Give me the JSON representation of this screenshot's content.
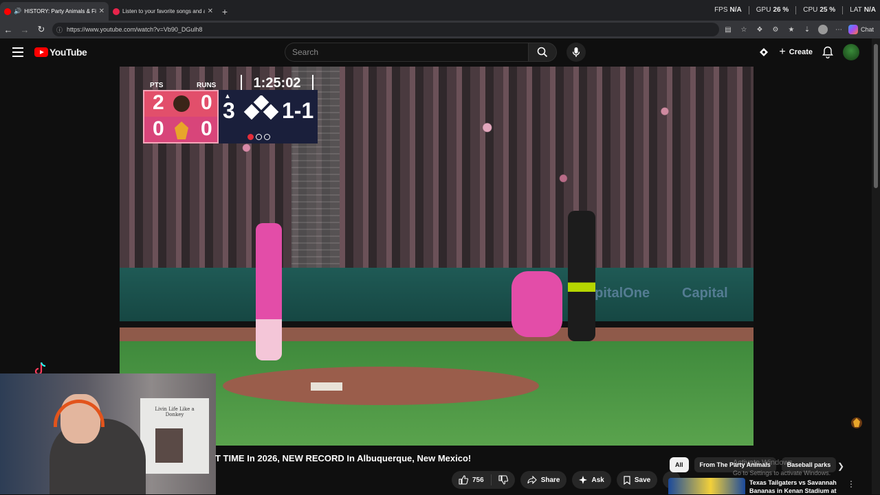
{
  "browser": {
    "tabs": [
      {
        "title": "HISTORY: Party Animals & Fi",
        "active": true,
        "favicon_color": "#ff0000",
        "audio": true
      },
      {
        "title": "Listen to your favorite songs and al",
        "active": false,
        "favicon_color": "#e8244b",
        "audio": false
      }
    ],
    "url": "https://www.youtube.com/watch?v=Vb90_DGulh8",
    "chat_label": "Chat",
    "perf": [
      {
        "label": "FPS",
        "value": "N/A"
      },
      {
        "label": "GPU",
        "value": "26 %"
      },
      {
        "label": "CPU",
        "value": "25 %"
      },
      {
        "label": "LAT",
        "value": "N/A"
      }
    ]
  },
  "youtube": {
    "logo_text": "YouTube",
    "search_placeholder": "Search",
    "create_label": "Create"
  },
  "scorebug": {
    "pts_label": "PTS",
    "runs_label": "RUNS",
    "clock": "1:25:02",
    "home_pts": "2",
    "home_runs": "0",
    "away_pts": "0",
    "away_runs": "0",
    "inning": "3",
    "count": "1-1",
    "outs": [
      true,
      false,
      false
    ]
  },
  "webcam": {
    "shirt_text": "Livin Life Like a Donkey"
  },
  "video": {
    "title_visible": "T TIME In 2026, NEW RECORD In Albuquerque, New Mexico!",
    "like_count": "756",
    "share_label": "Share",
    "ask_label": "Ask",
    "save_label": "Save"
  },
  "sidebar_chips": [
    {
      "label": "All",
      "selected": true
    },
    {
      "label": "From The Party Animals",
      "selected": false
    },
    {
      "label": "Baseball parks",
      "selected": false
    }
  ],
  "windows_watermark": {
    "line1": "Activate Windows",
    "line2": "Go to Settings to activate Windows."
  },
  "recommended": {
    "title": "Texas Tailgaters vs Savannah Bananas in Kenan Stadium at ..."
  }
}
